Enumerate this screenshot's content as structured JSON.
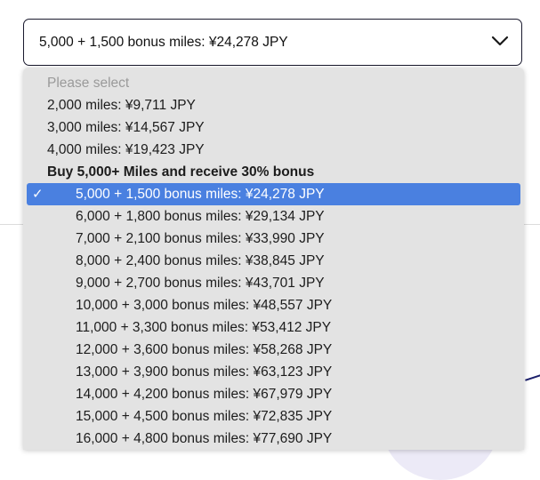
{
  "select": {
    "value": "5,000 + 1,500 bonus miles: ¥24,278 JPY",
    "chevron_icon": "chevron-down-icon"
  },
  "dropdown": {
    "placeholder": "Please select",
    "options_top": [
      "2,000 miles: ¥9,711 JPY",
      "3,000 miles: ¥14,567 JPY",
      "4,000 miles: ¥19,423 JPY"
    ],
    "group_label": "Buy 5,000+ Miles and receive 30% bonus",
    "check_icon": "checkmark-icon",
    "check_glyph": "✓",
    "selected_index": 0,
    "group_options": [
      "5,000 + 1,500 bonus miles: ¥24,278 JPY",
      "6,000 + 1,800 bonus miles: ¥29,134 JPY",
      "7,000 + 2,100 bonus miles: ¥33,990 JPY",
      "8,000 + 2,400 bonus miles: ¥38,845 JPY",
      "9,000 + 2,700 bonus miles: ¥43,701 JPY",
      "10,000 + 3,000 bonus miles: ¥48,557 JPY",
      "11,000 + 3,300 bonus miles: ¥53,412 JPY",
      "12,000 + 3,600 bonus miles: ¥58,268 JPY",
      "13,000 + 3,900 bonus miles: ¥63,123 JPY",
      "14,000 + 4,200 bonus miles: ¥67,979 JPY",
      "15,000 + 4,500 bonus miles: ¥72,835 JPY",
      "16,000 + 4,800 bonus miles: ¥77,690 JPY"
    ]
  }
}
